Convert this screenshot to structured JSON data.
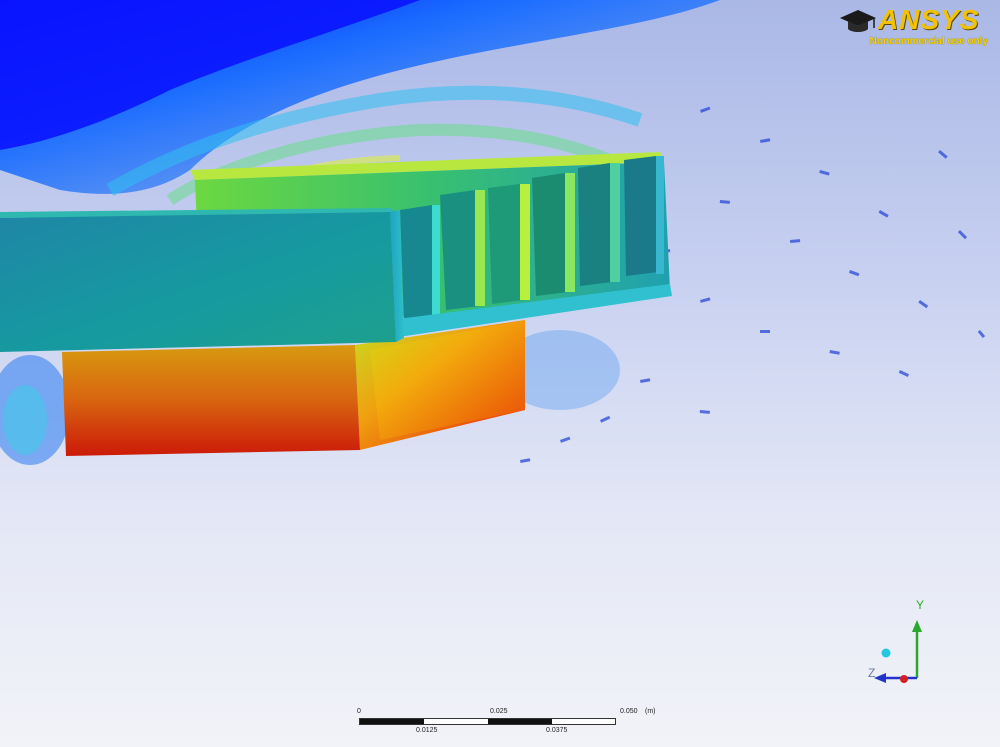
{
  "logo": {
    "brand_text": "ANSYS",
    "subtitle": "Noncommercial use only",
    "brand_color": "#f2c200",
    "icon": "graduation-cap-icon"
  },
  "scale_bar": {
    "top_labels": [
      "0",
      "0.025",
      "0.050",
      "(m)"
    ],
    "bottom_labels": [
      "0.0125",
      "0.0375"
    ]
  },
  "triad": {
    "y_label": "Y",
    "z_label": "Z",
    "y_color": "#2aa82a",
    "z_color": "#2233cc",
    "x_color": "#d22020",
    "iso_ball_color": "#22c8e0"
  },
  "colors": {
    "background_top": "#aab8e6",
    "background_bottom": "#f2f3f8",
    "velocity_low": "#0010ff",
    "velocity_mid": "#20e0e0",
    "velocity_high": "#ffff20",
    "temp_hot": "#d42000",
    "heatsink_base": "#1a9aa0"
  }
}
